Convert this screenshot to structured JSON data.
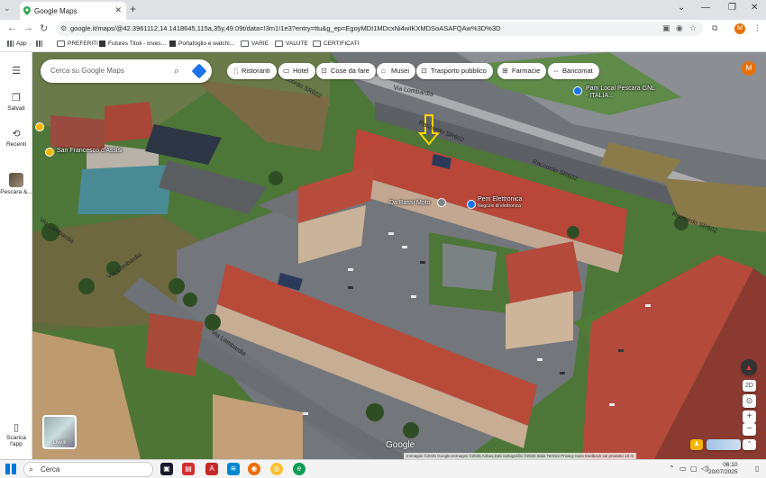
{
  "browser": {
    "tab_title": "Google Maps",
    "new_tab_symbol": "+",
    "close_symbol": "✕",
    "url": "google.it/maps/@42.3961112,14.1418645,115a,35y,49.09t/data=!3m1!1e3?entry=ttu&g_ep=EgoyMDI1MDcxNi4wIKXMDSoASAFQAw%3D%3D",
    "profile_initial": "M",
    "window_controls": [
      "⌄",
      "—",
      "❐",
      "✕"
    ]
  },
  "bookmarks": [
    {
      "label": "App",
      "icon": "apps-grid-icon"
    },
    {
      "label": "",
      "icon": "grid-icon"
    },
    {
      "label": "PREFERITI",
      "icon": "folder-icon"
    },
    {
      "label": "Futures Titoli - Inves...",
      "icon": "site-icon"
    },
    {
      "label": "Portafoglio e watchl...",
      "icon": "site-icon"
    },
    {
      "label": "VARIE",
      "icon": "folder-icon"
    },
    {
      "label": "VALUTE",
      "icon": "folder-icon"
    },
    {
      "label": "CERTIFICATI",
      "icon": "folder-icon"
    }
  ],
  "sidebar": {
    "menu_icon": "☰",
    "items": [
      {
        "label": "Salvati",
        "icon": "bookmark-icon",
        "glyph": "❐"
      },
      {
        "label": "Recenti",
        "icon": "history-icon",
        "glyph": "⟲"
      },
      {
        "label": "Pescara &...",
        "icon": "place-thumbnail-icon",
        "glyph": ""
      }
    ],
    "download": {
      "label": "Scarica l'app",
      "glyph": "▯"
    }
  },
  "map": {
    "search_placeholder": "Cerca su Google Maps",
    "chips": [
      {
        "label": "Ristoranti",
        "icon": "restaurant-icon",
        "glyph": "🍴"
      },
      {
        "label": "Hotel",
        "icon": "hotel-icon",
        "glyph": "▭"
      },
      {
        "label": "Cose da fare",
        "icon": "things-to-do-icon",
        "glyph": "⊡"
      },
      {
        "label": "Musei",
        "icon": "museum-icon",
        "glyph": "⌂"
      },
      {
        "label": "Trasporto pubblico",
        "icon": "transit-icon",
        "glyph": "⊡"
      },
      {
        "label": "Farmacie",
        "icon": "pharmacy-icon",
        "glyph": "⊞"
      },
      {
        "label": "Bancomat",
        "icon": "atm-icon",
        "glyph": "⇔"
      }
    ],
    "avatar": "M",
    "place_labels": {
      "pam": "Pam Local Pescara GNL - ITALIA...",
      "sanfrancesco": "San Francesco d'Assisi",
      "bassi": "Da Bassi Moto",
      "pem": "Pem Elettronica",
      "pem_sub": "Negozio di elettronica"
    },
    "road_labels": {
      "raccordo1": "Raccordo SR602",
      "raccordo2": "Raccordo SR602",
      "raccordo3": "Raccordo SR602",
      "raccordo4": "Raccordo SR602",
      "lombardia1": "Via Lombardia",
      "lombardia2": "Via Lombardia",
      "lombardia3": "Via Lombardia",
      "lombardia4": "Via Lombardia"
    },
    "layers_label": "Livelli",
    "google_logo": "Google",
    "attribution": "Immagini ©2025 Google,Immagini ©2025 Airbus,Dati cartografici ©2025   Italia   Termini   Privacy   Invia feedback sul prodotto   10 m",
    "tilt_label": "2D",
    "zoom_in": "+",
    "zoom_out": "−"
  },
  "taskbar": {
    "search_label": "Cerca",
    "time": "06:10",
    "date": "20/07/2025"
  },
  "colors": {
    "roof": "#b5473a",
    "road": "#6f7277",
    "grass": "#4f7a3a",
    "accent": "#1a73e8"
  }
}
